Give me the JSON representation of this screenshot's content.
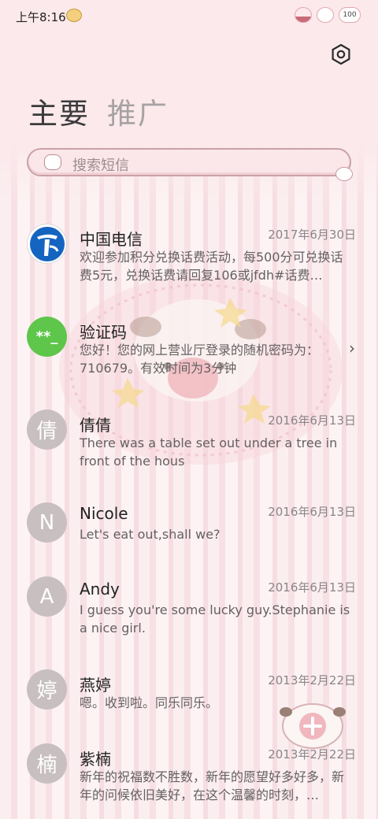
{
  "status": {
    "time": "上午8:16",
    "battery": "100"
  },
  "tabs": {
    "main": "主要",
    "promo": "推广"
  },
  "search": {
    "placeholder": "搜索短信"
  },
  "messages": [
    {
      "name": "中国电信",
      "date": "2017年6月30日",
      "preview": "欢迎参加积分兑换话费活动，每500分可兑换话费5元，兑换话费请回复106或jfdh#话费…",
      "avatar": ""
    },
    {
      "name": "验证码",
      "date": "",
      "preview": "您好！您的网上营业厅登录的随机密码为：710679。有效时间为3分钟",
      "avatar": "**_"
    },
    {
      "name": "倩倩",
      "date": "2016年6月13日",
      "preview": "There was a table set out under a tree in front of the hous",
      "avatar": "倩"
    },
    {
      "name": "Nicole",
      "date": "2016年6月13日",
      "preview": "Let's eat out,shall we?",
      "avatar": "N"
    },
    {
      "name": "Andy",
      "date": "2016年6月13日",
      "preview": "I guess you're some lucky guy.Stephanie is a nice girl.",
      "avatar": "A"
    },
    {
      "name": "燕婷",
      "date": "2013年2月22日",
      "preview": "嗯。收到啦。同乐同乐。",
      "avatar": "婷"
    },
    {
      "name": "紫楠",
      "date": "2013年2月22日",
      "preview": "新年的祝福数不胜数，新年的愿望好多好多，新年的问候依旧美好，在这个温馨的时刻，…",
      "avatar": "楠"
    }
  ],
  "icons": {
    "settings": "gear-icon",
    "chevron": "chevron-right-icon",
    "compose": "compose-icon"
  },
  "colors": {
    "accent": "#5ec64a",
    "telecom": "#1565c0",
    "theme_pink": "#fbe9ec"
  }
}
